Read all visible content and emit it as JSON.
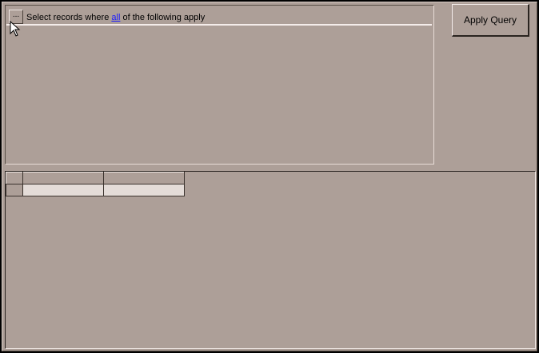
{
  "query": {
    "ellipsis_label": "...",
    "prefix": "Select records where ",
    "link": "all",
    "suffix": " of the following apply"
  },
  "apply_button": {
    "label": "Apply Query"
  },
  "grid": {
    "columns": [
      "",
      ""
    ],
    "rows": [
      [
        "",
        ""
      ]
    ]
  }
}
